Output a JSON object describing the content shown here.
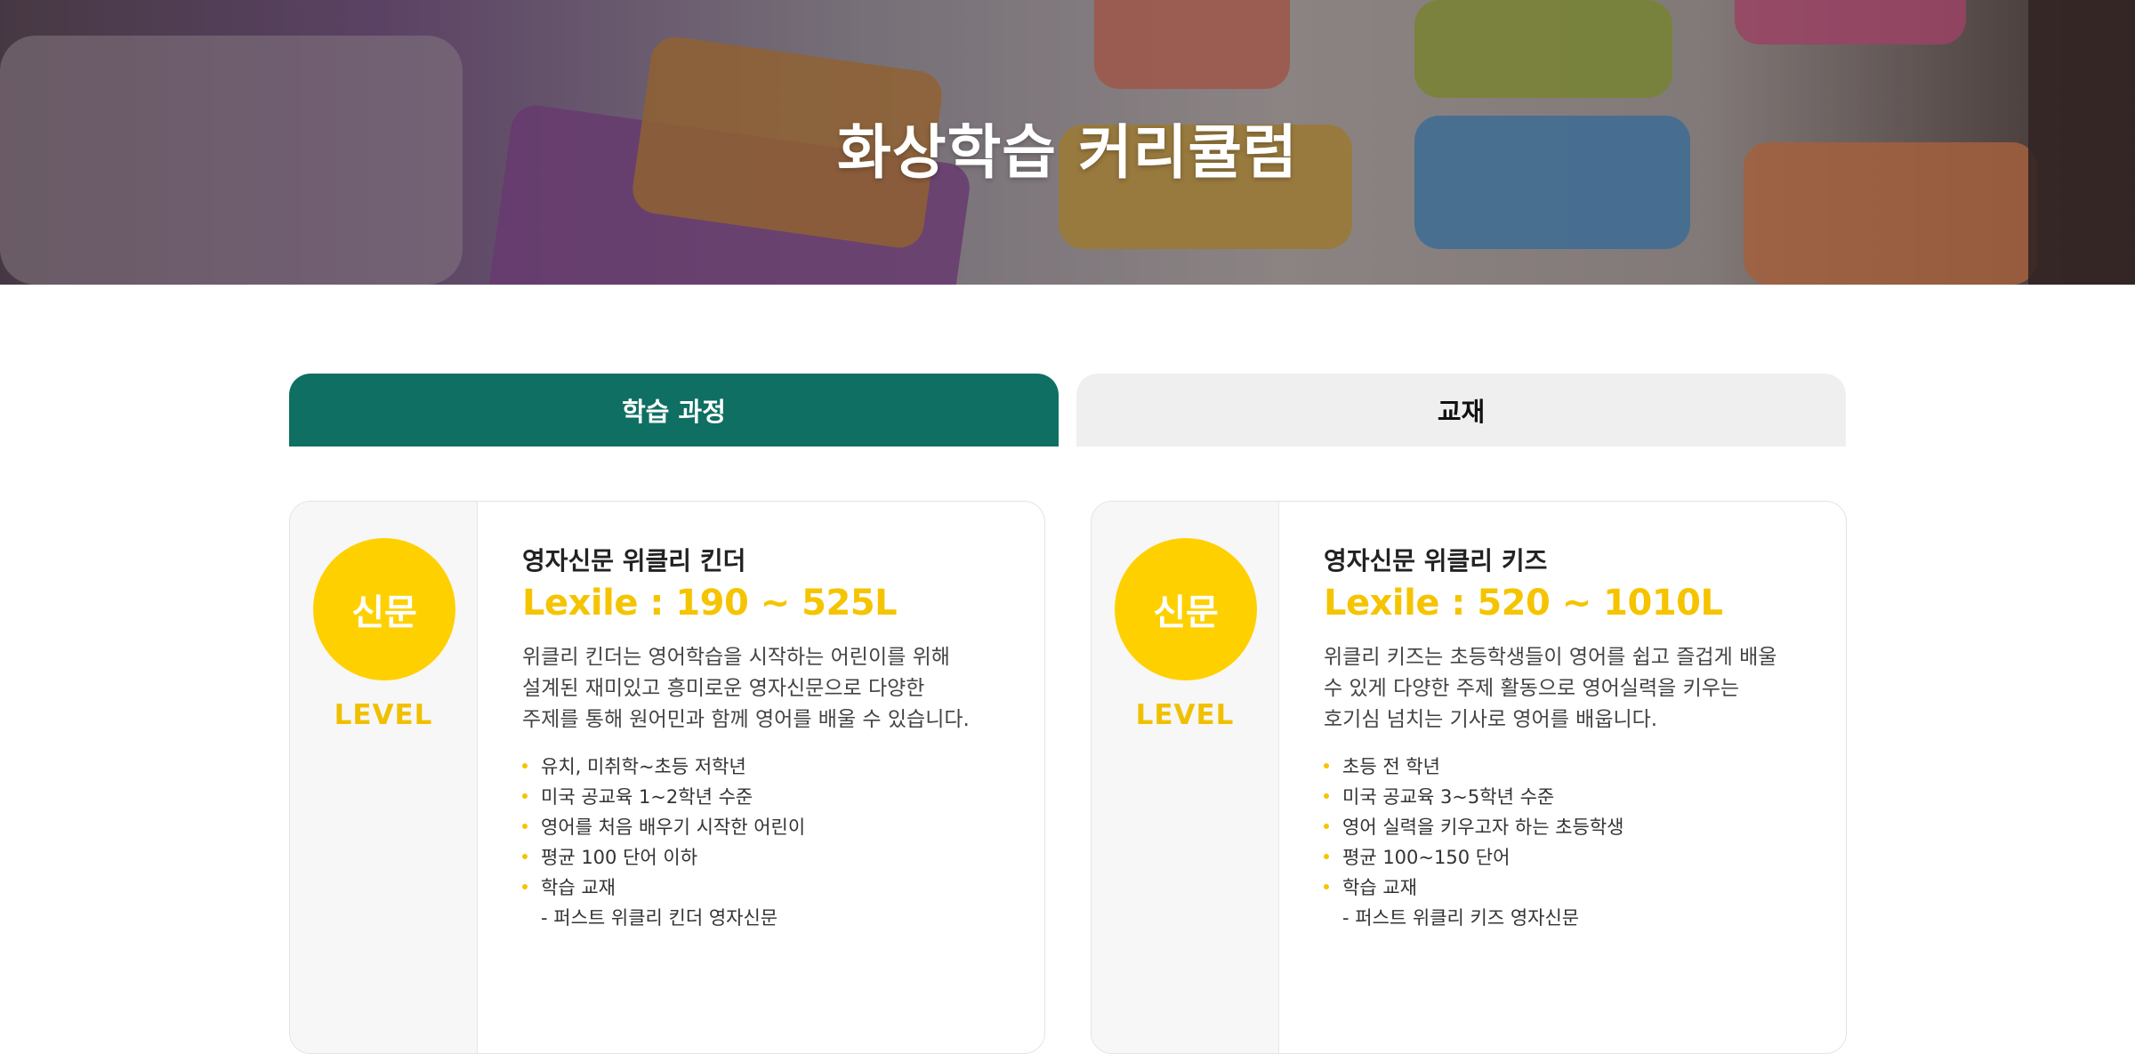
{
  "hero": {
    "title": "화상학습 커리큘럼"
  },
  "tabs": [
    {
      "label": "학습 과정",
      "active": true
    },
    {
      "label": "교재",
      "active": false
    }
  ],
  "cards": [
    {
      "badge": "신문",
      "level_label": "LEVEL",
      "title": "영자신문 위클리 킨더",
      "lexile": "Lexile : 190 ~ 525L",
      "description_lines": [
        "위클리 킨더는 영어학습을 시작하는 어린이를 위해",
        "설계된 재미있고 흥미로운 영자신문으로 다양한",
        "주제를 통해 원어민과 함께 영어를 배울 수 있습니다."
      ],
      "bullets": [
        "유치, 미취학~초등 저학년",
        "미국 공교육 1~2학년 수준",
        "영어를 처음 배우기 시작한 어린이",
        "평균 100 단어 이하",
        "학습 교재"
      ],
      "sub_item": "- 퍼스트 위클리 킨더 영자신문"
    },
    {
      "badge": "신문",
      "level_label": "LEVEL",
      "title": "영자신문 위클리 키즈",
      "lexile": "Lexile : 520 ~ 1010L",
      "description_lines": [
        "위클리 키즈는 초등학생들이 영어를 쉽고 즐겁게 배울",
        "수 있게 다양한 주제 활동으로 영어실력을 키우는",
        "호기심 넘치는 기사로 영어를 배웁니다."
      ],
      "bullets": [
        "초등 전 학년",
        "미국 공교육 3~5학년 수준",
        "영어 실력을 키우고자 하는 초등학생",
        "평균 100~150 단어",
        "학습 교재"
      ],
      "sub_item": "- 퍼스트 위클리 키즈 영자신문"
    }
  ],
  "colors": {
    "accent_green": "#0e6f62",
    "accent_yellow": "#ffd000",
    "tab_inactive_bg": "#efefef"
  }
}
